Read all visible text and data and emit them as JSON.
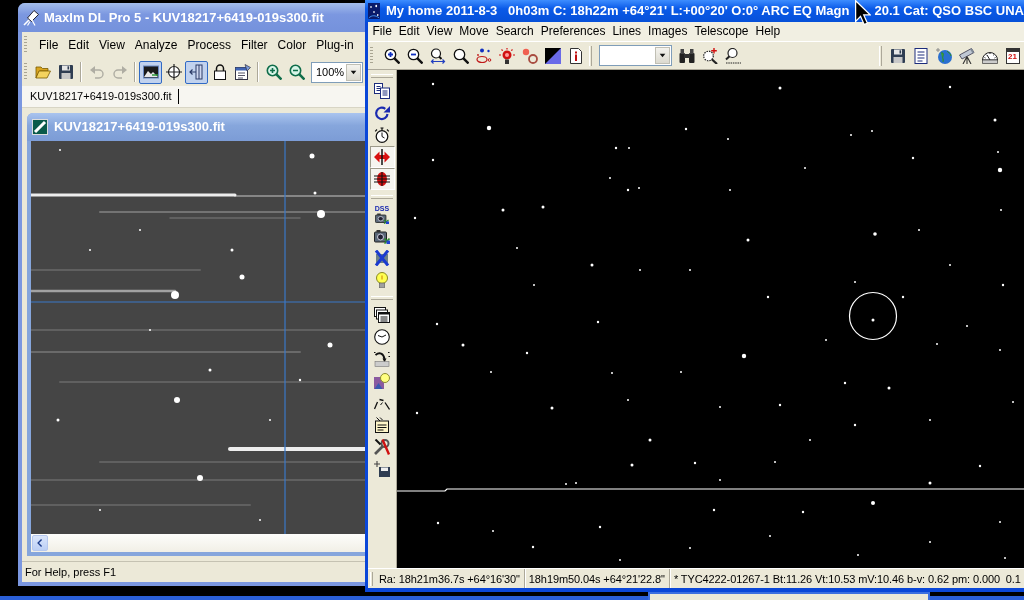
{
  "maxim_window": {
    "title": "MaxIm DL Pro 5 - KUV18217+6419-019s300.fit",
    "menu": [
      "File",
      "Edit",
      "View",
      "Analyze",
      "Process",
      "Filter",
      "Color",
      "Plug-in"
    ],
    "toolbar": [
      {
        "pressed": false,
        "disabled": false
      },
      {
        "pressed": false,
        "disabled": false
      },
      {
        "pressed": false,
        "disabled": true
      },
      {
        "pressed": false,
        "disabled": true
      },
      {
        "pressed": true,
        "disabled": false
      },
      {
        "pressed": false,
        "disabled": false
      },
      {
        "pressed": true,
        "disabled": false
      },
      {
        "pressed": false,
        "disabled": false
      },
      {
        "pressed": false,
        "disabled": false
      },
      {
        "pressed": false,
        "disabled": false
      },
      {
        "pressed": false,
        "disabled": false
      }
    ],
    "zoom_combo": {
      "value": "100%"
    },
    "document_tab": "KUV18217+6419-019s300.fit",
    "image_window": {
      "title": "KUV18217+6419-019s300.fit"
    },
    "status_bar": "For Help, press F1"
  },
  "chart_window": {
    "title": [
      "My home 2011-8-3   0h03m C: 18h22m +64°21' L:+00°20' O:0° ARC EQ Magn",
      "20.1 Cat: QSO BSC UNA"
    ],
    "menu": [
      "File",
      "Edit",
      "View",
      "Move",
      "Search",
      "Preferences",
      "Lines",
      "Images",
      "Telescope",
      "Help"
    ],
    "toolbar": {
      "calendar_day": "21"
    },
    "side_toolbar": [
      {
        "pressed": false
      },
      {
        "pressed": false
      },
      {
        "pressed": false
      },
      {
        "pressed": true
      },
      {
        "pressed": true
      },
      {
        "pressed": false,
        "label": "DSS"
      },
      {
        "pressed": false
      },
      {
        "pressed": false
      },
      {
        "pressed": false
      },
      {
        "pressed": false
      },
      {
        "pressed": false
      },
      {
        "pressed": false
      },
      {
        "pressed": false
      },
      {
        "pressed": false
      },
      {
        "pressed": false
      },
      {
        "pressed": false
      },
      {
        "pressed": false
      }
    ],
    "status_bar": [
      "Ra: 18h21m36.7s +64°16'30\"",
      "18h19m50.04s +64°21'22.8\"",
      "* TYC4222-01267-1 Bt:11.26 Vt:10.53 mV:10.46 b-v: 0.62 pm: 0.000  0.1"
    ]
  }
}
